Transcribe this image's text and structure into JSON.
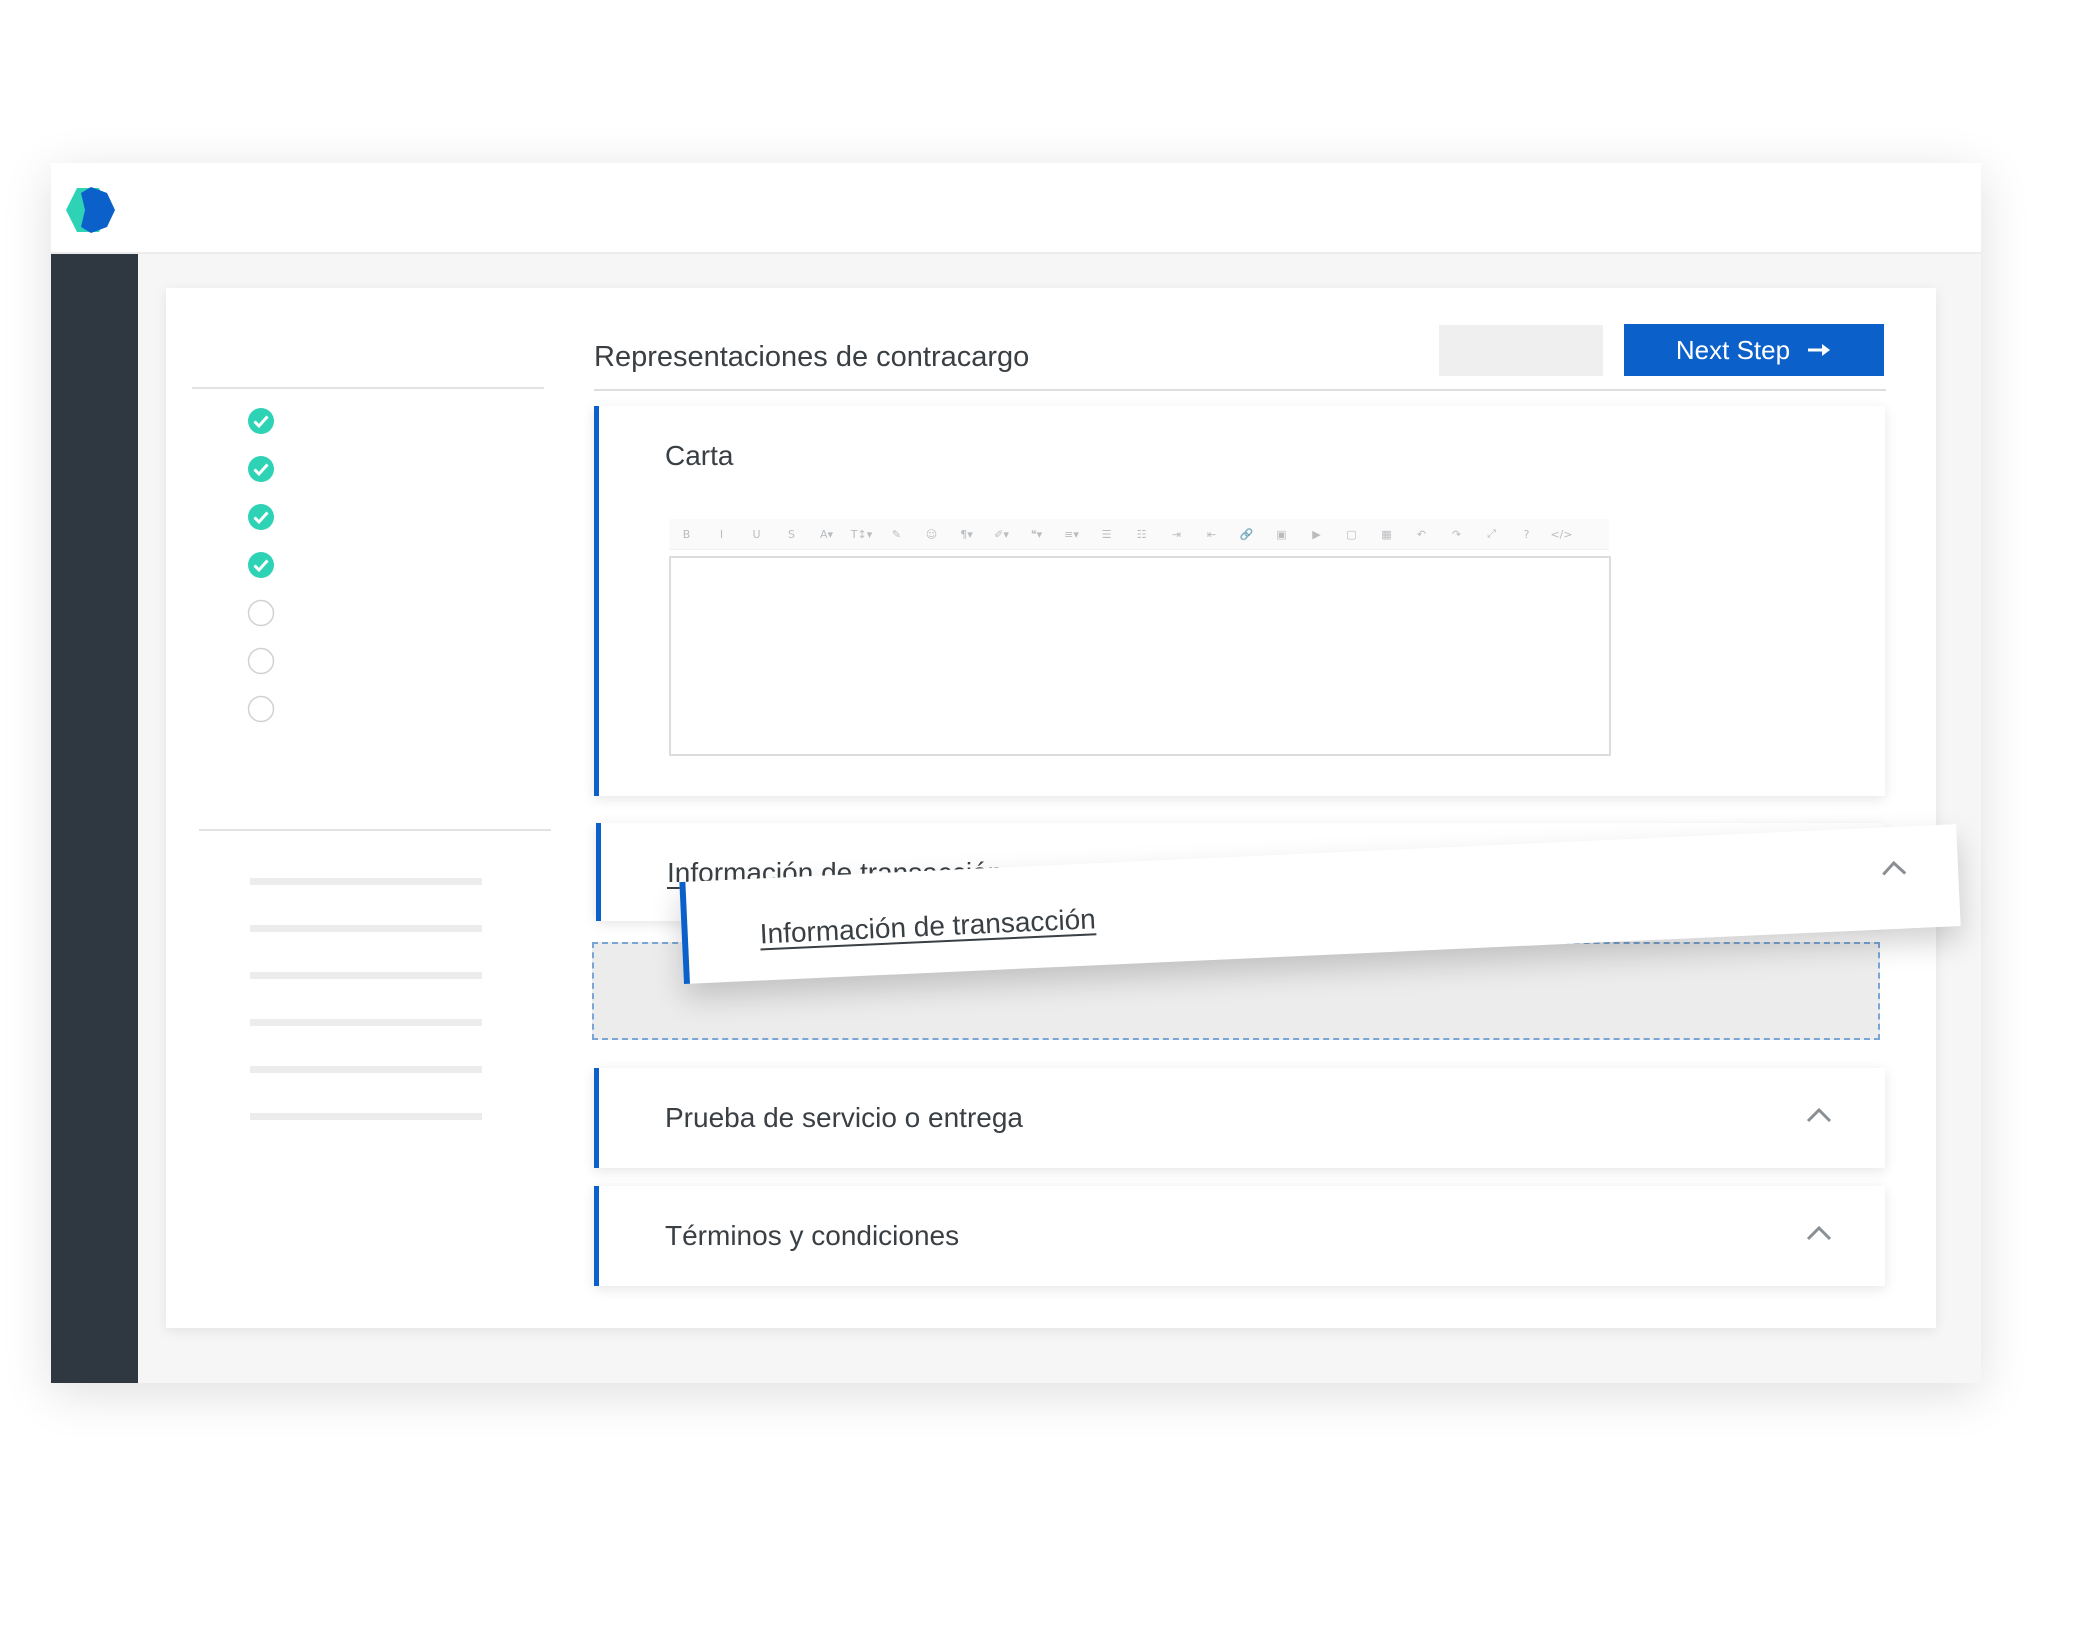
{
  "header": {
    "logo_icon": "hexagon-logo-icon",
    "colors": {
      "logo_teal": "#2ed3b6",
      "logo_blue": "#0b61c9"
    }
  },
  "sidebar": {
    "color": "#2f3740"
  },
  "steps": [
    {
      "status": "complete",
      "icon": "check-circle-icon"
    },
    {
      "status": "complete",
      "icon": "check-circle-icon"
    },
    {
      "status": "complete",
      "icon": "check-circle-icon"
    },
    {
      "status": "complete",
      "icon": "check-circle-icon"
    },
    {
      "status": "pending",
      "icon": "empty-circle-icon"
    },
    {
      "status": "pending",
      "icon": "empty-circle-icon"
    },
    {
      "status": "pending",
      "icon": "empty-circle-icon"
    }
  ],
  "main": {
    "title": "Representaciones de contracargo",
    "next_button_label": "Next Step",
    "next_button_icon": "arrow-right-icon",
    "accent_color": "#0b61c9",
    "check_color": "#2ed3b6"
  },
  "sections": {
    "carta": {
      "title": "Carta",
      "toolbar": [
        "B",
        "I",
        "U",
        "S",
        "A▾",
        "T↕▾",
        "✎",
        "☺",
        "¶▾",
        "✐▾",
        "❝▾",
        "≡▾",
        "☰",
        "☷",
        "⇥",
        "⇤",
        "🔗",
        "▣",
        "▶",
        "▢",
        "▦",
        "↶",
        "↷",
        "⤢",
        "?",
        "</>"
      ]
    },
    "informacion": {
      "title": "Información de transacción"
    },
    "dragged": {
      "title": "Información de transacción",
      "chevron_icon": "chevron-up-icon"
    },
    "prueba": {
      "title": "Prueba de servicio o entrega",
      "chevron_icon": "chevron-up-icon"
    },
    "terminos": {
      "title": "Términos y condiciones",
      "chevron_icon": "chevron-up-icon"
    }
  }
}
